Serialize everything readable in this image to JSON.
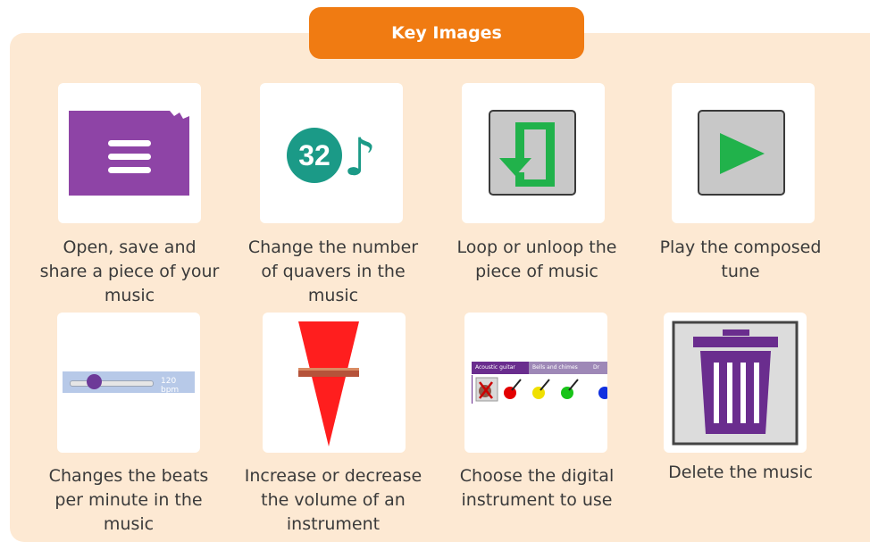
{
  "header": {
    "title": "Key Images"
  },
  "items": [
    {
      "icon": "menu-document-icon",
      "caption_lines": [
        "Open, save and",
        "share a piece of your",
        "music"
      ]
    },
    {
      "icon": "quaver-count-icon",
      "badge": "32",
      "note_glyph": "♪",
      "caption_lines": [
        "Change the number",
        "of quavers in the",
        "music"
      ]
    },
    {
      "icon": "loop-icon",
      "caption_lines": [
        "Loop or unloop the",
        "piece of music"
      ]
    },
    {
      "icon": "play-icon",
      "caption_lines": [
        "Play the composed",
        "tune"
      ]
    },
    {
      "icon": "tempo-slider-icon",
      "bpm_text": "120 bpm",
      "tempo_level": 0.3,
      "caption_lines": [
        "Changes the beats",
        "per minute in the",
        "music"
      ]
    },
    {
      "icon": "volume-icon",
      "caption_lines": [
        "Increase or decrease",
        "the volume of an",
        "instrument"
      ]
    },
    {
      "icon": "instrument-picker-icon",
      "tabs": [
        "Acoustic guitar",
        "Bells and chimes",
        "Dr"
      ],
      "caption_lines": [
        "Choose the digital",
        "instrument to use"
      ]
    },
    {
      "icon": "trash-icon",
      "caption_lines": [
        "Delete the music"
      ]
    }
  ],
  "colors": {
    "panel": "#fde9d3",
    "accent": "#f07b12",
    "purple": "#8e44a6",
    "teal": "#1b9a87",
    "green": "#21b24b",
    "red": "#ff1e1e",
    "trash": "#6a2d8e"
  }
}
